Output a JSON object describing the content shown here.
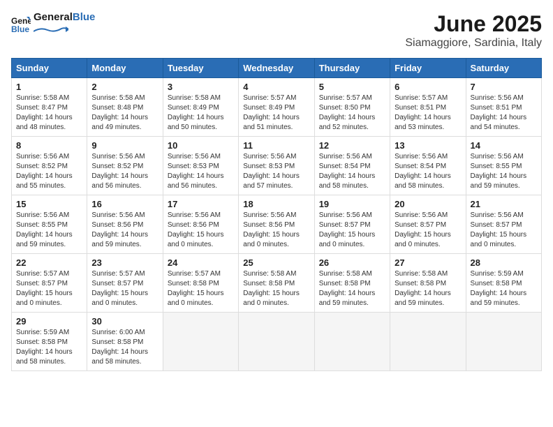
{
  "header": {
    "logo_line1": "General",
    "logo_line2": "Blue",
    "title": "June 2025",
    "subtitle": "Siamaggiore, Sardinia, Italy"
  },
  "weekdays": [
    "Sunday",
    "Monday",
    "Tuesday",
    "Wednesday",
    "Thursday",
    "Friday",
    "Saturday"
  ],
  "weeks": [
    [
      {
        "day": "1",
        "info": "Sunrise: 5:58 AM\nSunset: 8:47 PM\nDaylight: 14 hours\nand 48 minutes."
      },
      {
        "day": "2",
        "info": "Sunrise: 5:58 AM\nSunset: 8:48 PM\nDaylight: 14 hours\nand 49 minutes."
      },
      {
        "day": "3",
        "info": "Sunrise: 5:58 AM\nSunset: 8:49 PM\nDaylight: 14 hours\nand 50 minutes."
      },
      {
        "day": "4",
        "info": "Sunrise: 5:57 AM\nSunset: 8:49 PM\nDaylight: 14 hours\nand 51 minutes."
      },
      {
        "day": "5",
        "info": "Sunrise: 5:57 AM\nSunset: 8:50 PM\nDaylight: 14 hours\nand 52 minutes."
      },
      {
        "day": "6",
        "info": "Sunrise: 5:57 AM\nSunset: 8:51 PM\nDaylight: 14 hours\nand 53 minutes."
      },
      {
        "day": "7",
        "info": "Sunrise: 5:56 AM\nSunset: 8:51 PM\nDaylight: 14 hours\nand 54 minutes."
      }
    ],
    [
      {
        "day": "8",
        "info": "Sunrise: 5:56 AM\nSunset: 8:52 PM\nDaylight: 14 hours\nand 55 minutes."
      },
      {
        "day": "9",
        "info": "Sunrise: 5:56 AM\nSunset: 8:52 PM\nDaylight: 14 hours\nand 56 minutes."
      },
      {
        "day": "10",
        "info": "Sunrise: 5:56 AM\nSunset: 8:53 PM\nDaylight: 14 hours\nand 56 minutes."
      },
      {
        "day": "11",
        "info": "Sunrise: 5:56 AM\nSunset: 8:53 PM\nDaylight: 14 hours\nand 57 minutes."
      },
      {
        "day": "12",
        "info": "Sunrise: 5:56 AM\nSunset: 8:54 PM\nDaylight: 14 hours\nand 58 minutes."
      },
      {
        "day": "13",
        "info": "Sunrise: 5:56 AM\nSunset: 8:54 PM\nDaylight: 14 hours\nand 58 minutes."
      },
      {
        "day": "14",
        "info": "Sunrise: 5:56 AM\nSunset: 8:55 PM\nDaylight: 14 hours\nand 59 minutes."
      }
    ],
    [
      {
        "day": "15",
        "info": "Sunrise: 5:56 AM\nSunset: 8:55 PM\nDaylight: 14 hours\nand 59 minutes."
      },
      {
        "day": "16",
        "info": "Sunrise: 5:56 AM\nSunset: 8:56 PM\nDaylight: 14 hours\nand 59 minutes."
      },
      {
        "day": "17",
        "info": "Sunrise: 5:56 AM\nSunset: 8:56 PM\nDaylight: 15 hours\nand 0 minutes."
      },
      {
        "day": "18",
        "info": "Sunrise: 5:56 AM\nSunset: 8:56 PM\nDaylight: 15 hours\nand 0 minutes."
      },
      {
        "day": "19",
        "info": "Sunrise: 5:56 AM\nSunset: 8:57 PM\nDaylight: 15 hours\nand 0 minutes."
      },
      {
        "day": "20",
        "info": "Sunrise: 5:56 AM\nSunset: 8:57 PM\nDaylight: 15 hours\nand 0 minutes."
      },
      {
        "day": "21",
        "info": "Sunrise: 5:56 AM\nSunset: 8:57 PM\nDaylight: 15 hours\nand 0 minutes."
      }
    ],
    [
      {
        "day": "22",
        "info": "Sunrise: 5:57 AM\nSunset: 8:57 PM\nDaylight: 15 hours\nand 0 minutes."
      },
      {
        "day": "23",
        "info": "Sunrise: 5:57 AM\nSunset: 8:57 PM\nDaylight: 15 hours\nand 0 minutes."
      },
      {
        "day": "24",
        "info": "Sunrise: 5:57 AM\nSunset: 8:58 PM\nDaylight: 15 hours\nand 0 minutes."
      },
      {
        "day": "25",
        "info": "Sunrise: 5:58 AM\nSunset: 8:58 PM\nDaylight: 15 hours\nand 0 minutes."
      },
      {
        "day": "26",
        "info": "Sunrise: 5:58 AM\nSunset: 8:58 PM\nDaylight: 14 hours\nand 59 minutes."
      },
      {
        "day": "27",
        "info": "Sunrise: 5:58 AM\nSunset: 8:58 PM\nDaylight: 14 hours\nand 59 minutes."
      },
      {
        "day": "28",
        "info": "Sunrise: 5:59 AM\nSunset: 8:58 PM\nDaylight: 14 hours\nand 59 minutes."
      }
    ],
    [
      {
        "day": "29",
        "info": "Sunrise: 5:59 AM\nSunset: 8:58 PM\nDaylight: 14 hours\nand 58 minutes."
      },
      {
        "day": "30",
        "info": "Sunrise: 6:00 AM\nSunset: 8:58 PM\nDaylight: 14 hours\nand 58 minutes."
      },
      {
        "day": "",
        "info": ""
      },
      {
        "day": "",
        "info": ""
      },
      {
        "day": "",
        "info": ""
      },
      {
        "day": "",
        "info": ""
      },
      {
        "day": "",
        "info": ""
      }
    ]
  ]
}
